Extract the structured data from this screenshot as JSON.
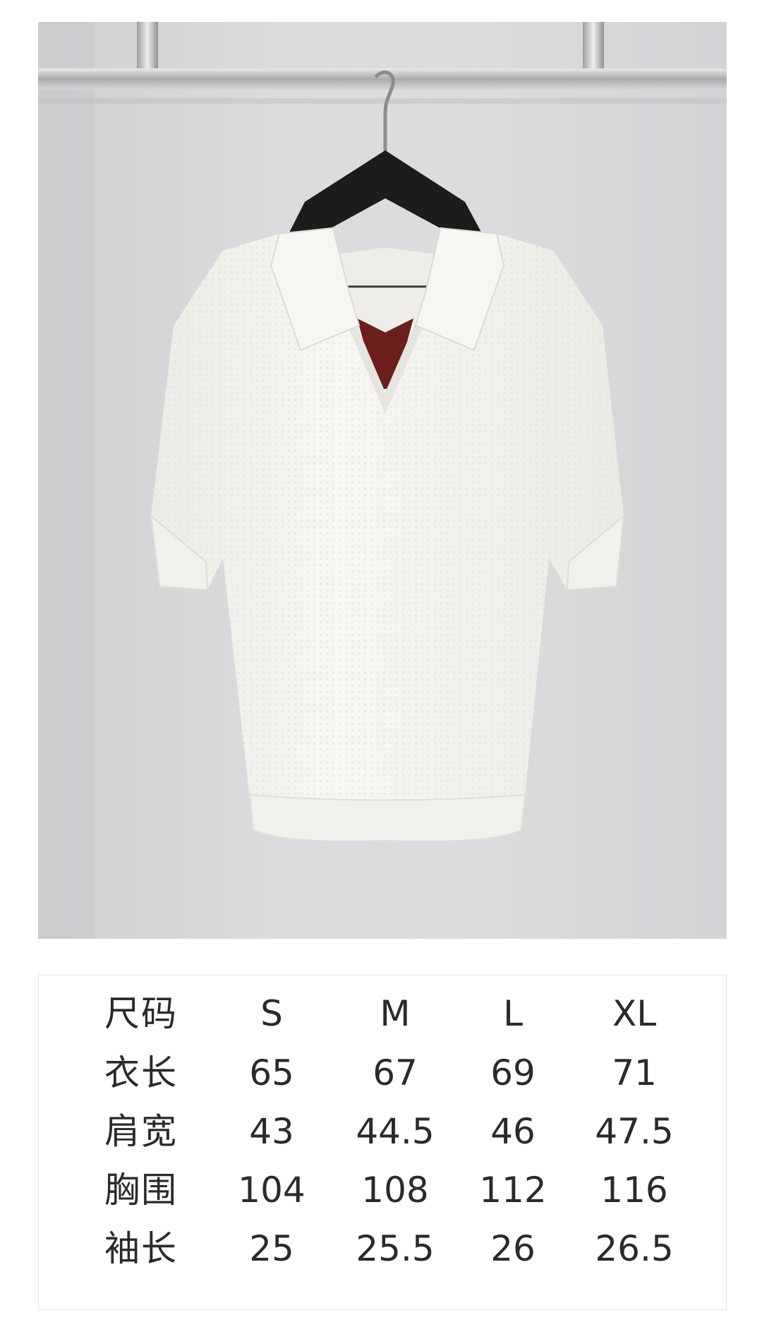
{
  "product_photo": {
    "subject": "white-knit-polo-shirt-on-hanger",
    "colors": {
      "garment": "#f6f5f1",
      "collar_lining": "#6a1f1c",
      "background": "#d9dadc",
      "hanger": "#1c1c1c",
      "rail": "#bfc1c3"
    }
  },
  "size_table": {
    "header": {
      "label": "尺码",
      "values": [
        "S",
        "M",
        "L",
        "XL"
      ]
    },
    "rows": [
      {
        "label": "衣长",
        "values": [
          "65",
          "67",
          "69",
          "71"
        ]
      },
      {
        "label": "肩宽",
        "values": [
          "43",
          "44.5",
          "46",
          "47.5"
        ]
      },
      {
        "label": "胸围",
        "values": [
          "104",
          "108",
          "112",
          "116"
        ]
      },
      {
        "label": "袖长",
        "values": [
          "25",
          "25.5",
          "26",
          "26.5"
        ]
      }
    ]
  }
}
